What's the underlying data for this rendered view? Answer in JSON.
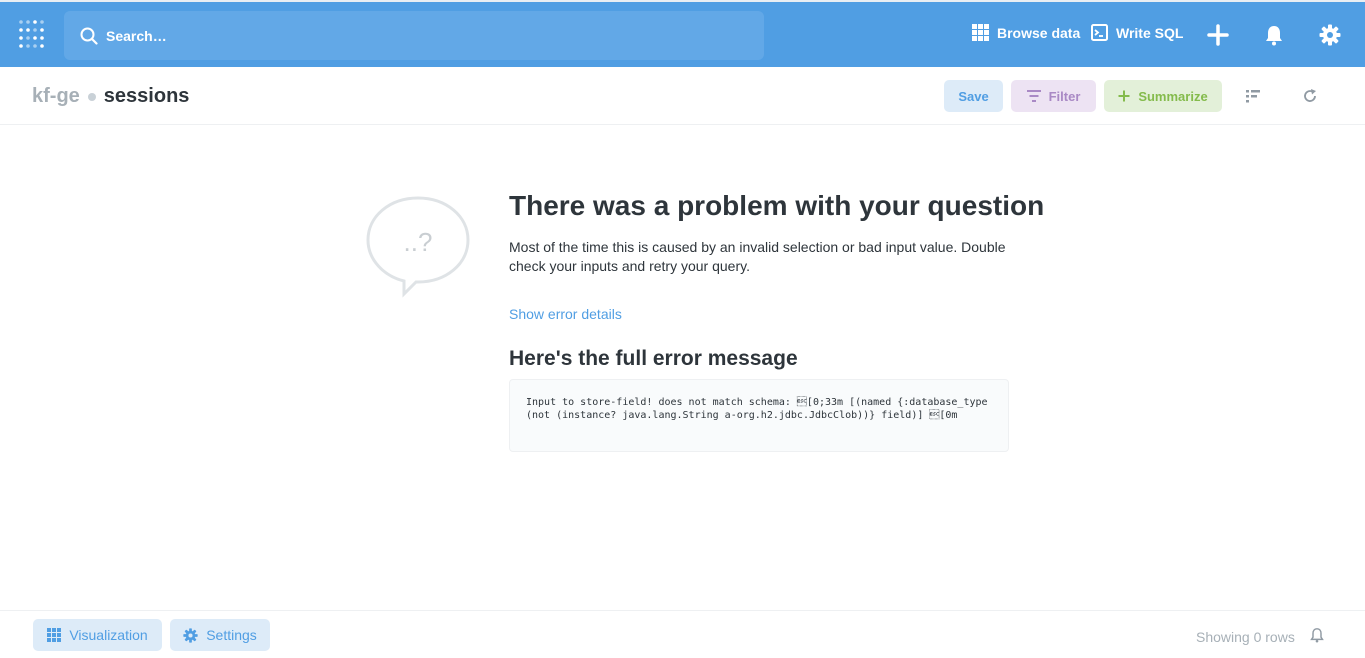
{
  "nav": {
    "search_placeholder": "Search…",
    "browse_data": "Browse data",
    "write_sql": "Write SQL"
  },
  "header": {
    "database": "kf-ge",
    "table": "sessions",
    "save": "Save",
    "filter": "Filter",
    "summarize": "Summarize"
  },
  "error": {
    "bubble_text": "..?",
    "title": "There was a problem with your question",
    "description": "Most of the time this is caused by an invalid selection or bad input value. Double check your inputs and retry your query.",
    "show_details": "Show error details",
    "subtitle": "Here's the full error message",
    "message": "Input to store-field! does not match schema: \u001b[0;33m [(named {:database_type (not (instance? java.lang.String a-org.h2.jdbc.JdbcClob))} field)] \u001b[0m"
  },
  "footer": {
    "visualization": "Visualization",
    "settings": "Settings",
    "rows": "Showing 0 rows"
  },
  "colors": {
    "brand": "#509ee3",
    "filter": "#a989c5",
    "summarize": "#84bb4c"
  }
}
